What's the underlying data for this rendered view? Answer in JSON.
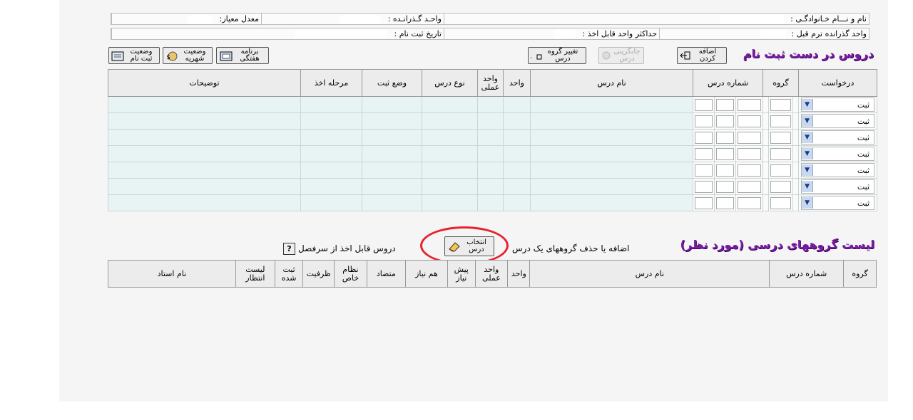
{
  "info": {
    "row1": {
      "name_label": "نام و نـــام خـانوادگـی :",
      "passed_units_label": "واحـد گـذرانـده :",
      "gpa_label": "معدل معیار:"
    },
    "row2": {
      "prev_term_units_label": "واحد گذرانده ترم قبل :",
      "max_units_label": "حداکثر واحد قابل اخذ :",
      "reg_date_label": "تاریخ ثبت نام :"
    }
  },
  "toolbar": {
    "section_title": "دروس در دست ثبت نام",
    "add_button": "اضافه کردن",
    "change_group_button": "تغییر گروه درس",
    "swap_button": "جابگزینی درس",
    "weekly_program_button": "برنامه هفتگی",
    "tuition_status_button": "وضعیت شهریه",
    "registration_status_button": "وضعیت ثبت نام"
  },
  "main_table": {
    "headers": {
      "request": "درخواست",
      "group": "گروه",
      "course_number": "شماره درس",
      "course_name": "نام درس",
      "units": "واحد",
      "practical_units": "واحد عملی",
      "course_type": "نوع درس",
      "reg_status": "وضع ثبت",
      "stage": "مرحله اخذ",
      "description": "توضیحات"
    },
    "rows": [
      {
        "request": "ثبت"
      },
      {
        "request": "ثبت"
      },
      {
        "request": "ثبت"
      },
      {
        "request": "ثبت"
      },
      {
        "request": "ثبت"
      },
      {
        "request": "ثبت"
      },
      {
        "request": "ثبت"
      }
    ]
  },
  "groups": {
    "section_title": "لیست گروههای درسی (مورد نظر)",
    "add_remove_text": "اضافه یا حذف گروههای یک درس",
    "select_button": "انتخاب درس",
    "syllabus_text": "دروس قابل اخذ از سرفصل",
    "help_label": "?",
    "headers": {
      "group": "گروه",
      "course_number": "شماره درس",
      "course_name": "نام درس",
      "units": "واحد",
      "practical_units": "واحد عملی",
      "prereq": "پیش نیاز",
      "coreq": "هم نیاز",
      "conflict": "متضاد",
      "special": "نظام خاص",
      "capacity": "ظرفیت",
      "registered": "ثبت شده",
      "waitlist": "لیست انتظار",
      "instructor": "نام استاد"
    }
  }
}
